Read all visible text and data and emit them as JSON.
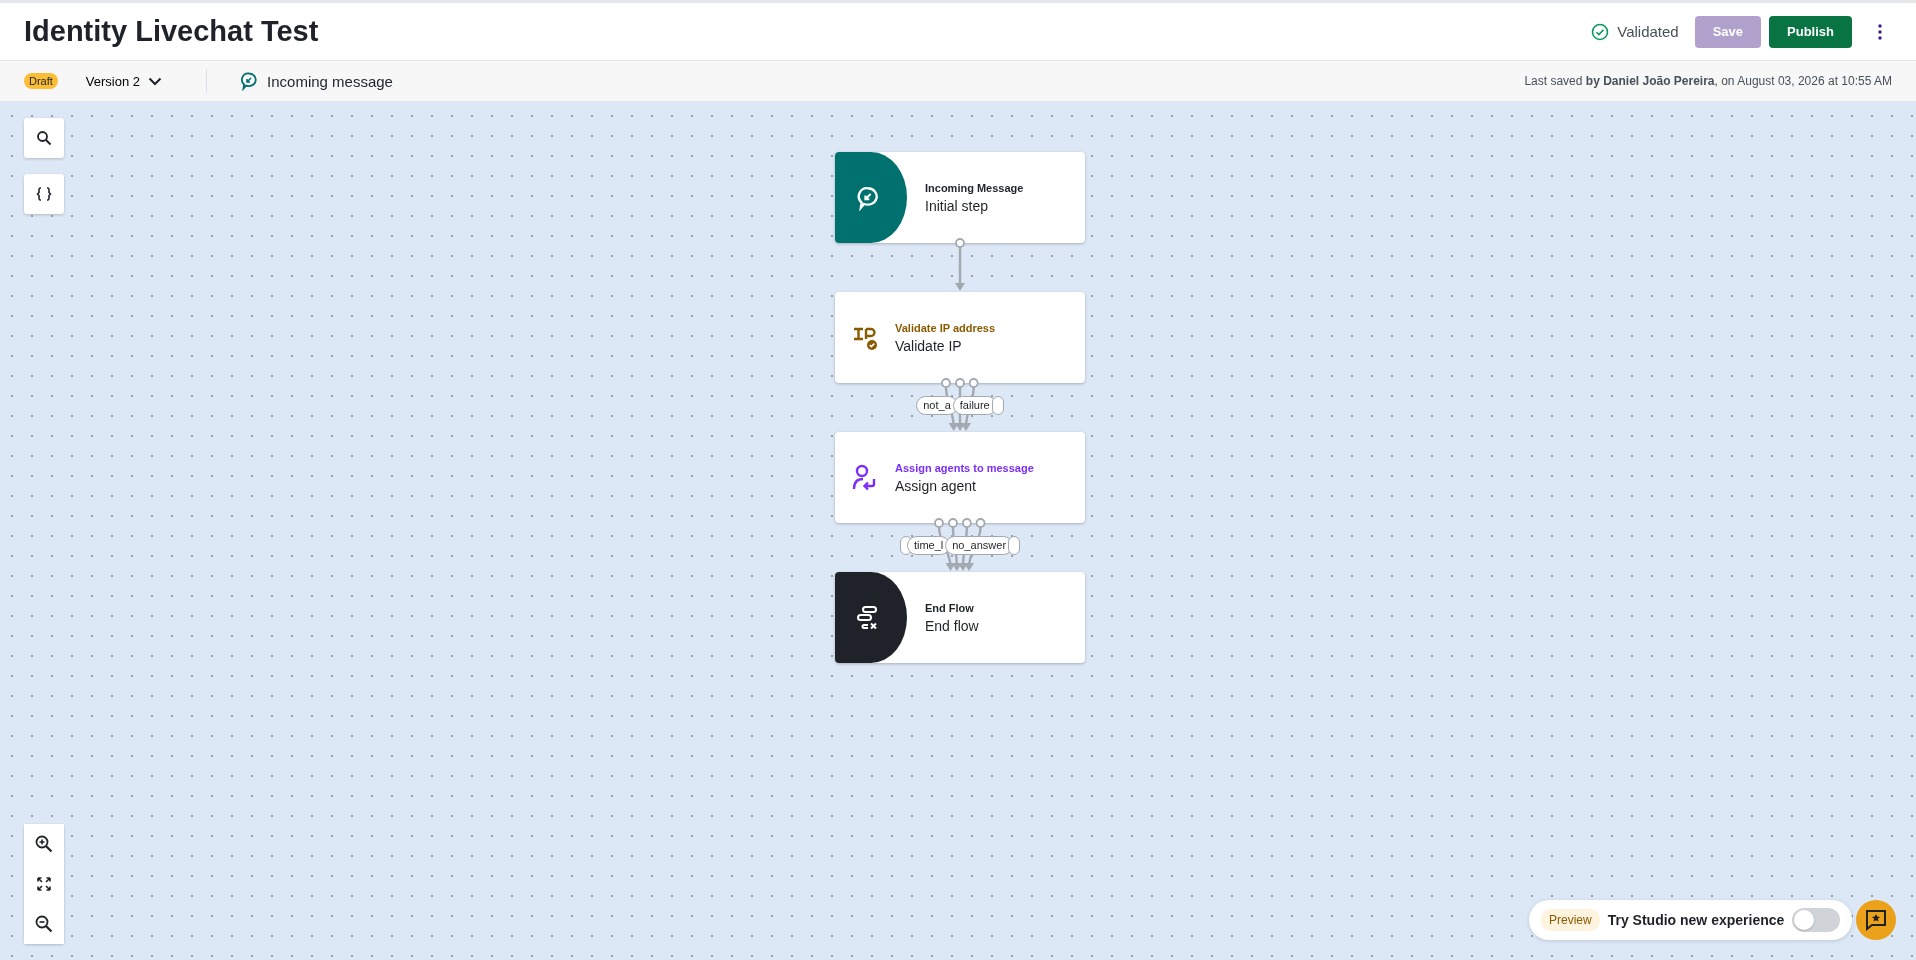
{
  "header": {
    "title": "Identity Livechat Test",
    "status": "Validated",
    "save": {
      "label": "Save",
      "disabled": true
    },
    "publish": {
      "label": "Publish"
    }
  },
  "subbar": {
    "badge": "Draft",
    "version": "Version 2",
    "trigger": "Incoming message",
    "last_saved": "Last saved **by Daniel João Pereira**, on August 03, 2026 at 10:55 AM"
  },
  "nodes": [
    {
      "kind": "start",
      "type": "Incoming Message",
      "name": "Initial step",
      "edges": [
        {
          "kind": "plain"
        }
      ]
    },
    {
      "kind": "ip",
      "type": "Validate IP address",
      "name": "Validate IP",
      "edges": [
        {
          "kind": "labelled",
          "label": "not_a"
        },
        {
          "kind": "labelled",
          "label": "failure"
        },
        {
          "kind": "covered"
        }
      ]
    },
    {
      "kind": "agent",
      "type": "Assign agents to message",
      "name": "Assign agent",
      "edges": [
        {
          "kind": "covered"
        },
        {
          "kind": "labelled",
          "label": "time_l"
        },
        {
          "kind": "labelled",
          "label": "no_answer"
        },
        {
          "kind": "covered"
        }
      ]
    },
    {
      "kind": "end",
      "type": "End Flow",
      "name": "End flow"
    }
  ],
  "preview": {
    "badge": "Preview",
    "label": "Try Studio new experience",
    "on": false
  }
}
